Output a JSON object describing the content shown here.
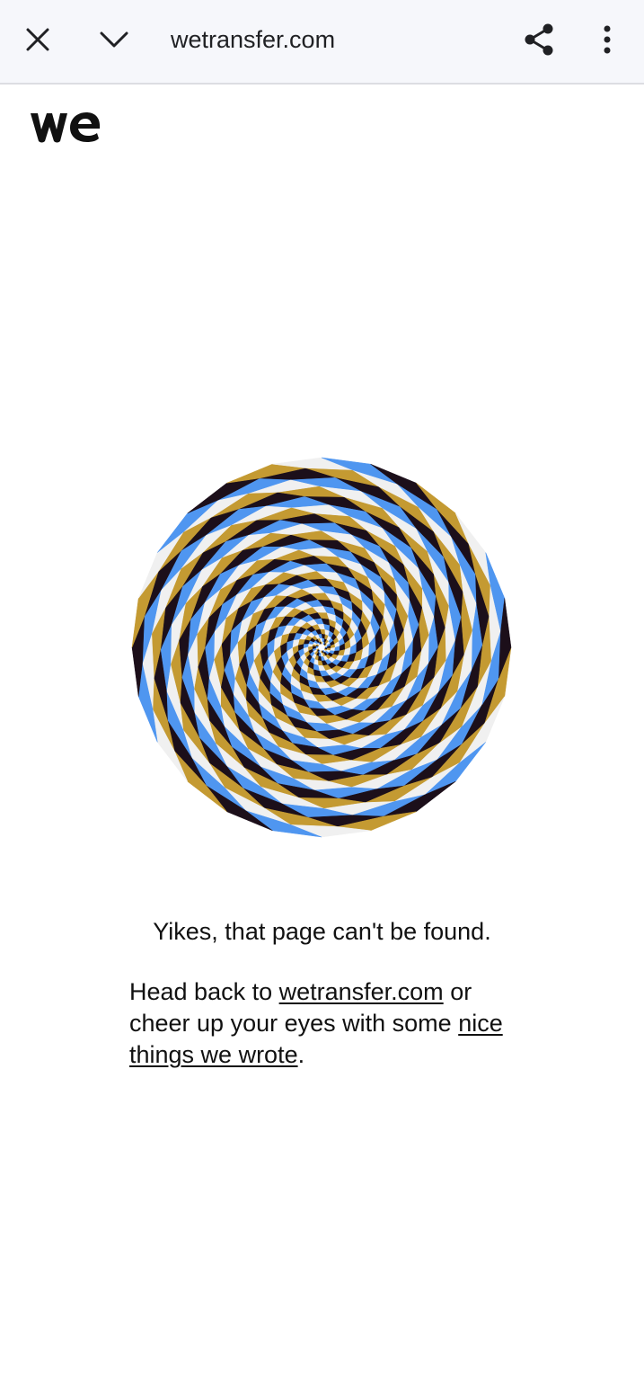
{
  "toolbar": {
    "close_icon": "close-icon",
    "expand_icon": "chevron-down-icon",
    "url": "wetransfer.com",
    "share_icon": "share-icon",
    "menu_icon": "more-vert-icon"
  },
  "page": {
    "logo": "we",
    "heading": "Yikes, that page can't be found.",
    "body": {
      "part1": "Head back to ",
      "link1": "wetransfer.com",
      "part2": " or cheer up your eyes with some ",
      "link2": "nice things we wrote",
      "part3": "."
    }
  },
  "colors": {
    "toolbar_bg": "#f6f7fb",
    "spiral": [
      "#1c0f1a",
      "#c49a32",
      "#f0f0f0",
      "#4f96f0"
    ]
  }
}
